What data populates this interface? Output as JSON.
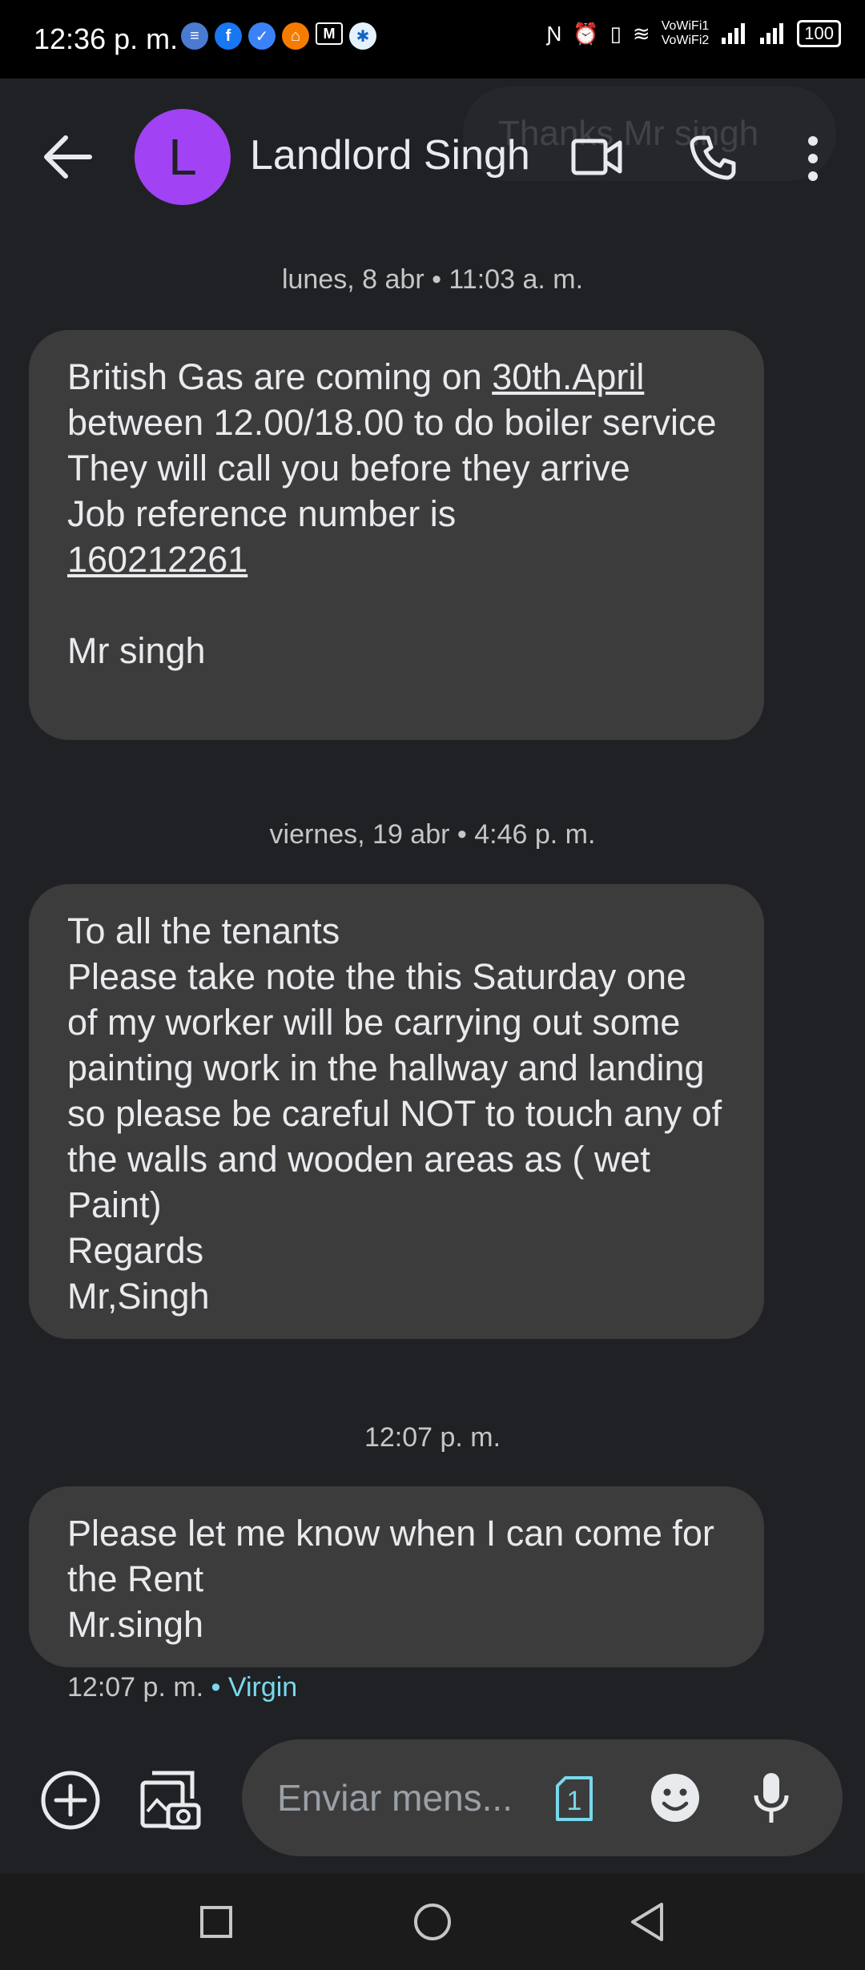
{
  "status_bar": {
    "time": "12:36 p. m.",
    "vowifi_1": "VoWiFi1",
    "vowifi_2": "VoWiFi2",
    "battery": "100"
  },
  "app_bar": {
    "avatar_letter": "L",
    "contact_name": "Landlord Singh",
    "ghost_chip_text": "Thanks Mr singh"
  },
  "conversation": {
    "separators": [
      "lunes, 8 abr • 11:03 a. m.",
      "viernes, 19 abr • 4:46 p. m.",
      "12:07 p. m."
    ],
    "message_1": {
      "before_link": "British Gas are coming on ",
      "date_link": "30th.April",
      "middle": "\nbetween 12.00/18.00 to do boiler service\nThey will call you before they arrive\nJob reference number is\n",
      "ref_link": "160212261",
      "after": "\n\nMr singh"
    },
    "message_2": "To all the tenants\nPlease take note the this Saturday one of my worker will be carrying out some painting work in the hallway and landing so please be careful NOT to touch any of the walls and wooden areas as ( wet Paint)\nRegards\nMr,Singh",
    "message_3": "Please let me know when I can come for the Rent\nMr.singh",
    "last_meta_time": "12:07 p. m.",
    "last_meta_sep": " • ",
    "last_meta_carrier": "Virgin"
  },
  "composer": {
    "placeholder": "Enviar mens...",
    "sim_number": "1"
  },
  "colors": {
    "background": "#202124",
    "bubble": "#3c3c3c",
    "avatar": "#a142f4",
    "carrier_accent": "#78d9ec"
  }
}
